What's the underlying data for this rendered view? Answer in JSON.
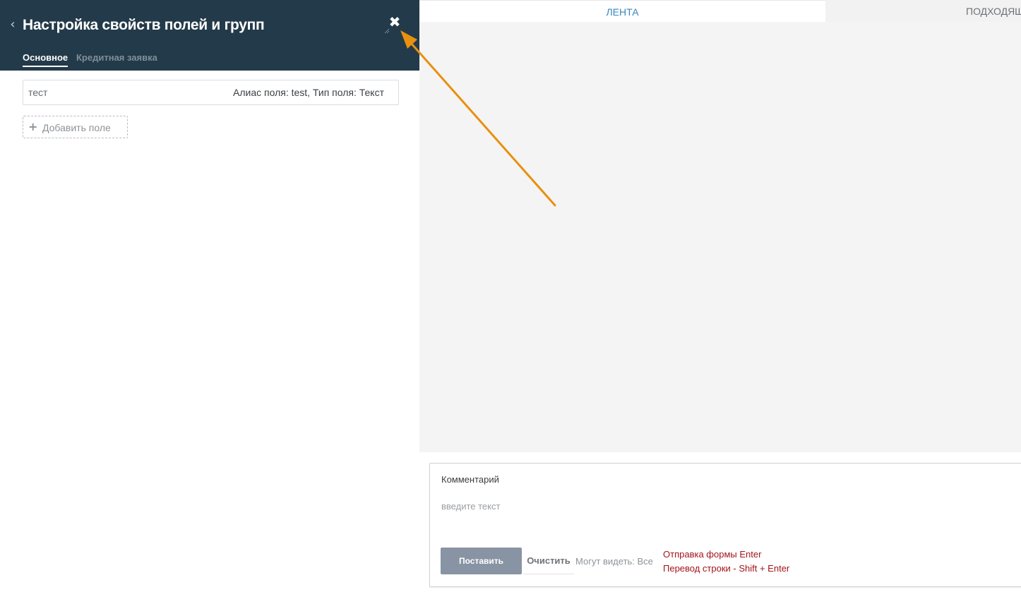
{
  "panel": {
    "back_icon": "chevron-left-icon",
    "title": "Настройка свойств полей и групп",
    "close_icon": "close-icon",
    "tabs": [
      {
        "label": "Основное",
        "active": true
      },
      {
        "label": "Кредитная заявка",
        "active": false
      }
    ],
    "fields": [
      {
        "name": "тест",
        "meta": "Алиас поля: test, Тип поля: Текст"
      }
    ],
    "add_field_icon": "plus-icon",
    "add_field_label": "Добавить поле"
  },
  "top_tabs": [
    {
      "label": "ЛЕНТА",
      "active": true
    },
    {
      "label": "ПОДХОДЯЩ",
      "active": false
    }
  ],
  "comment": {
    "label": "Комментарий",
    "placeholder": "введите текст",
    "post_label": "Поставить",
    "clear_label": "Очистить",
    "visibility": "Могут видеть: Все",
    "hint_submit": "Отправка формы Enter",
    "hint_newline": "Перевод строки - Shift + Enter"
  },
  "colors": {
    "header_bg": "#233a4a",
    "accent_blue": "#3a86bd",
    "hint_red": "#a3141b",
    "post_button_bg": "#8894a3",
    "annotation_arrow": "#e8900f"
  }
}
